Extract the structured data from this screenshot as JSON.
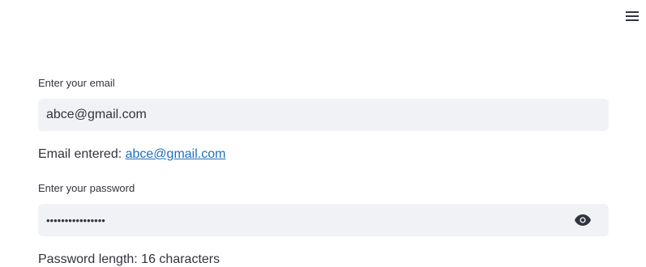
{
  "header": {
    "menu_icon": "hamburger-menu-icon"
  },
  "email": {
    "label": "Enter your email",
    "value": "abce@gmail.com",
    "result_prefix": "Email entered: ",
    "result_link": "abce@gmail.com"
  },
  "password": {
    "label": "Enter your password",
    "value": "••••••••••••••••",
    "toggle_icon": "eye-icon",
    "result_text": "Password length: 16 characters"
  },
  "colors": {
    "field_bg": "#f0f2f6",
    "text": "#31333f",
    "link": "#1e6fbf"
  }
}
